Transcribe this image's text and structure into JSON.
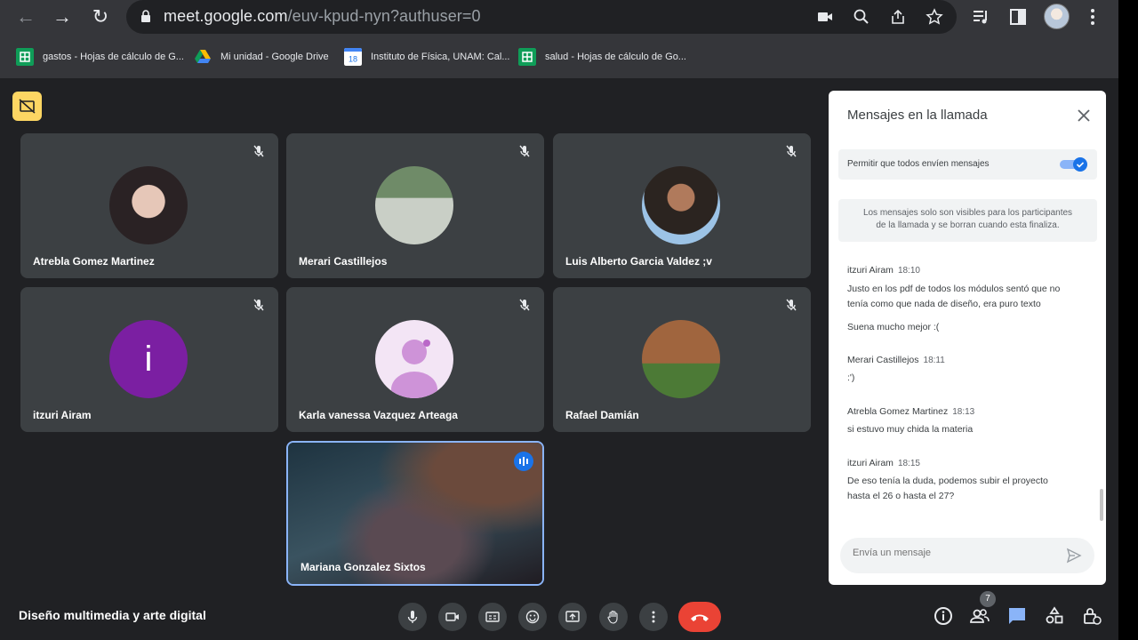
{
  "browser": {
    "url_main": "meet.google.com",
    "url_rest": "/euv-kpud-nyn?authuser=0",
    "bookmarks": [
      {
        "label": "gastos - Hojas de cálculo de G...",
        "color": "#0f9d58"
      },
      {
        "label": "Mi unidad - Google Drive",
        "color": "#4285f4"
      },
      {
        "label": "Instituto de Física, UNAM: Cal...",
        "color": "#4285f4"
      },
      {
        "label": "salud - Hojas de cálculo de Go...",
        "color": "#0f9d58"
      }
    ],
    "calendar_day": "18"
  },
  "tiles": [
    {
      "name": "Atrebla Gomez Martinez",
      "muted": true
    },
    {
      "name": "Merari Castillejos",
      "muted": true
    },
    {
      "name": "Luis Alberto Garcia Valdez ;v",
      "muted": true
    },
    {
      "name": "itzuri Airam",
      "muted": true,
      "initial": "i",
      "avatar_color": "#7b1fa2"
    },
    {
      "name": "Karla vanessa Vazquez Arteaga",
      "muted": true
    },
    {
      "name": "Rafael Damián",
      "muted": true
    },
    {
      "name": "Mariana Gonzalez Sixtos",
      "muted": false,
      "speaking": true
    }
  ],
  "meeting": {
    "title": "Diseño multimedia y arte digital",
    "participant_count": "7"
  },
  "chat_panel": {
    "title": "Mensajes en la llamada",
    "permit_label": "Permitir que todos envíen mensajes",
    "permit_on": true,
    "notice_line1": "Los mensajes solo son visibles para los participantes",
    "notice_line2": "de la llamada y se borran cuando esta finaliza.",
    "messages": [
      {
        "sender": "itzuri Airam",
        "time": "18:10",
        "lines": [
          "Justo en los pdf de todos los módulos sentó que no",
          "tenía como que nada de diseño, era puro texto"
        ],
        "extra": "Suena mucho mejor :("
      },
      {
        "sender": "Merari Castillejos",
        "time": "18:11",
        "lines": [
          ":')"
        ]
      },
      {
        "sender": "Atrebla Gomez Martinez",
        "time": "18:13",
        "lines": [
          "si estuvo muy chida la materia"
        ]
      },
      {
        "sender": "itzuri Airam",
        "time": "18:15",
        "lines": [
          "De eso tenía la duda, podemos subir el proyecto",
          "hasta el 26 o hasta el 27?"
        ]
      }
    ],
    "compose_placeholder": "Envía un mensaje"
  },
  "colors": {
    "accent": "#1a73e8",
    "hangup": "#ea4335",
    "chat_active": "#8ab4f8",
    "captions": "#fdd663"
  }
}
